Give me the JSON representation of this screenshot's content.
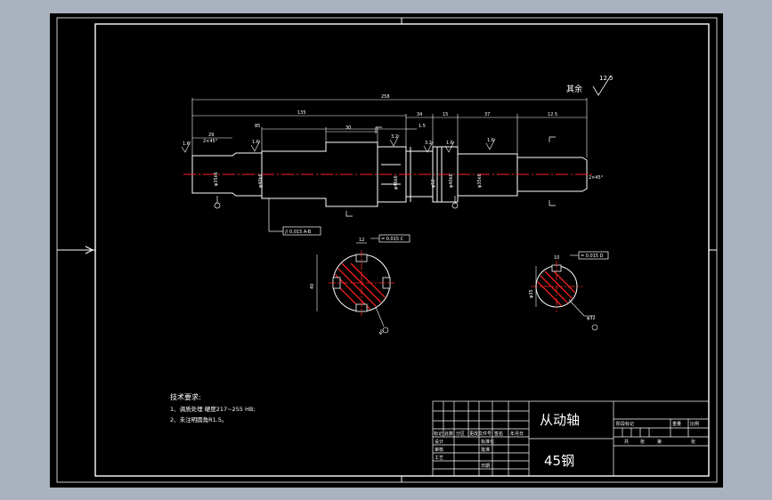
{
  "drawing": {
    "title_surface": "其余",
    "roughness_global": "12.5",
    "dims": {
      "overall": "258",
      "d135": "135",
      "d85": "85",
      "d29": "29",
      "d30": "30",
      "d34": "34",
      "d15": "15",
      "d37": "37",
      "d12_5": "12.5",
      "d1_5": "1.5",
      "chamfer_left": "2×45°",
      "chamfer_right": "2×45°",
      "rough_a": "1.6",
      "rough_b": "1.6",
      "rough_c": "3.2",
      "rough_d": "3.2",
      "rough_e": "1.6",
      "rough_f": "1.6",
      "rough_g": "3.2",
      "dia_1": "φ35k6",
      "dia_2": "φ40k6",
      "dia_3": "φ46k6",
      "dia_4": "φ52",
      "dia_5": "φ40k6",
      "dia_6": "φ35k6",
      "tol_frame": "// 0.015 A-B",
      "tol_frame_2": "= 0.015 C",
      "tol_frame_3": "= 0.015 D",
      "section_dim_1": "40",
      "section_dim_2": "40",
      "section_dim_3": "φ35",
      "section_dim_4": "φ32",
      "key_1": "12",
      "key_2": "10"
    },
    "tech_requirements": {
      "heading": "技术要求:",
      "line1": "1、调质处理 硬度217~255 HB;",
      "line2": "2、未注明圆角R1.5。"
    },
    "title_block": {
      "part_name": "从动轴",
      "material": "45钢",
      "row_labels": [
        "设计",
        "审核",
        "标准化",
        "工艺",
        "批准",
        "日期"
      ],
      "header_labels": [
        "标记",
        "处数",
        "分区",
        "更改文件号",
        "签名",
        "年月日"
      ],
      "right_labels": [
        "阶段标记",
        "重量",
        "比例"
      ],
      "scale_labels": [
        "共",
        "张",
        "第",
        "张"
      ]
    }
  }
}
